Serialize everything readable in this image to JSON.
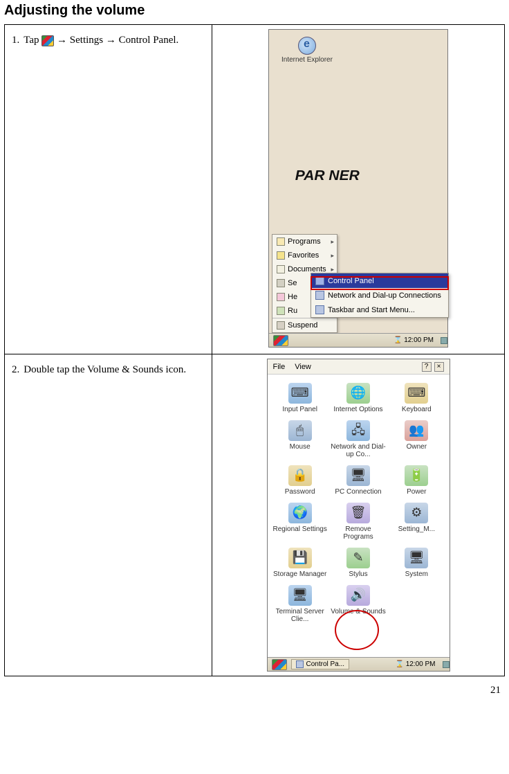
{
  "heading": "Adjusting the volume",
  "page_number": "21",
  "step1": {
    "number": "1.",
    "text_before_icon": "Tap",
    "text_after_icon": "→ Settings → Control Panel."
  },
  "step2": {
    "number": "2.",
    "text": "Double tap the Volume & Sounds icon."
  },
  "screenshot1": {
    "desktop_icon_label": "Internet Explorer",
    "brand_logo_text": "PAR  NER",
    "start_menu": {
      "programs": "Programs",
      "favorites": "Favorites",
      "documents": "Documents",
      "settings": "Se",
      "help": "He",
      "run": "Ru",
      "suspend": "Suspend"
    },
    "settings_submenu": {
      "control_panel": "Control Panel",
      "network": "Network and Dial-up Connections",
      "taskbar": "Taskbar and Start Menu..."
    },
    "taskbar_time": "12:00 PM"
  },
  "screenshot2": {
    "menubar": {
      "file": "File",
      "view": "View"
    },
    "items": {
      "input_panel": "Input Panel",
      "internet_options": "Internet Options",
      "keyboard": "Keyboard",
      "mouse": "Mouse",
      "network": "Network and Dial-up Co...",
      "owner": "Owner",
      "password": "Password",
      "pc_connection": "PC Connection",
      "power": "Power",
      "regional_settings": "Regional Settings",
      "remove_programs": "Remove Programs",
      "setting_m": "Setting_M...",
      "storage_manager": "Storage Manager",
      "stylus": "Stylus",
      "system": "System",
      "terminal": "Terminal Server Clie...",
      "volume_sounds": "Volume & Sounds"
    },
    "taskbar_button": "Control Pa...",
    "taskbar_time": "12:00 PM"
  }
}
